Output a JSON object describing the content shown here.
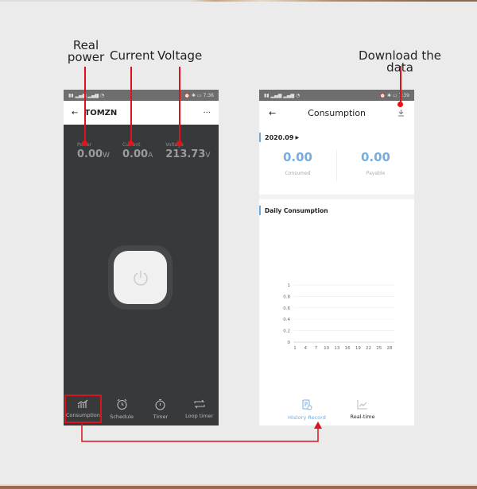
{
  "annotations": {
    "real_power": "Real\npower",
    "current": "Current",
    "voltage": "Voltage",
    "download": "Download the data"
  },
  "phone_left": {
    "status_time": "7:36",
    "title": "TOMZN",
    "metrics": [
      {
        "label": "Power",
        "value": "0.00",
        "unit": "W"
      },
      {
        "label": "Current",
        "value": "0.00",
        "unit": "A"
      },
      {
        "label": "Voltage",
        "value": "213.73",
        "unit": "V"
      }
    ],
    "tabs": [
      {
        "label": "Consumption",
        "icon": "bar-chart-icon"
      },
      {
        "label": "Schedule",
        "icon": "alarm-clock-icon"
      },
      {
        "label": "Timer",
        "icon": "stopwatch-icon"
      },
      {
        "label": "Loop timer",
        "icon": "loop-icon"
      }
    ]
  },
  "phone_right": {
    "status_time": "7:39",
    "title": "Consumption",
    "month": "2020.09",
    "consumed_value": "0.00",
    "consumed_label": "Consumed",
    "payable_value": "0.00",
    "payable_label": "Payable",
    "section_title": "Daily Consumption",
    "tabs": [
      {
        "label": "History Record",
        "icon": "document-clock-icon",
        "active": true
      },
      {
        "label": "Real-time",
        "icon": "line-chart-icon",
        "active": false
      }
    ]
  },
  "colors": {
    "accent": "#74aee0",
    "annotation_red": "#d9141c",
    "dark_bg": "#38393b"
  },
  "chart_data": {
    "type": "line",
    "title": "Daily Consumption",
    "x": [
      1,
      4,
      7,
      10,
      13,
      16,
      19,
      22,
      25,
      28
    ],
    "x_tick_labels": [
      "1",
      "4",
      "7",
      "10",
      "13",
      "16",
      "19",
      "22",
      "25",
      "28"
    ],
    "y_tick_labels": [
      "0",
      "0.2",
      "0.4",
      "0.6",
      "0.8",
      "1"
    ],
    "ylim": [
      0,
      1
    ],
    "series": [],
    "grid": true
  }
}
